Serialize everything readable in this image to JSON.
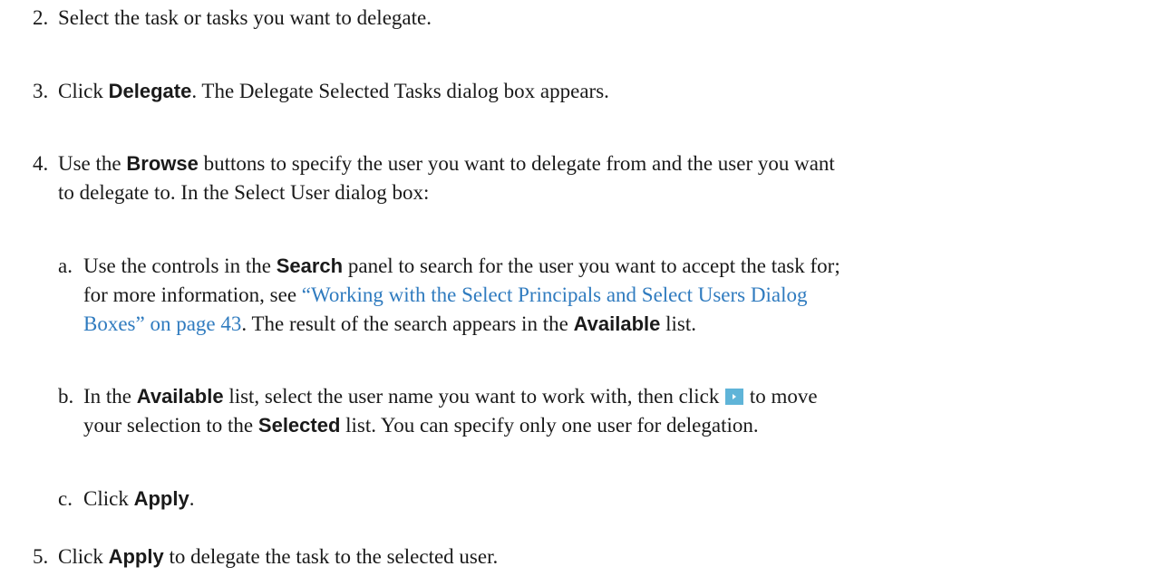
{
  "steps": {
    "s2": {
      "num": "2.",
      "text": "Select the task or tasks you want to delegate."
    },
    "s3": {
      "num": "3.",
      "pre": "Click ",
      "bold": "Delegate",
      "post": ". The Delegate Selected Tasks dialog box appears."
    },
    "s4": {
      "num": "4.",
      "pre": "Use the ",
      "bold": "Browse",
      "post": " buttons to specify the user you want to delegate from and the user you want",
      "line2": "to delegate to. In the Select User dialog box:",
      "a": {
        "num": "a.",
        "pre": "Use the controls in the ",
        "bold": "Search",
        "post": " panel to search for the user you want to accept the task for;",
        "line2_pre": "for more information, see ",
        "link1": "“Working with the Select Principals and Select Users Dialog",
        "link2": "Boxes” on page 43",
        "line3_post": ". The result of the search appears in the ",
        "bold2": "Available",
        "line3_end": " list."
      },
      "b": {
        "num": "b.",
        "pre": "In the ",
        "bold": "Available",
        "mid": " list, select the user name you want to work with, then click ",
        "button_icon": "move-right-arrow-icon",
        "post": " to move",
        "line2_pre": "your selection to the ",
        "bold2": "Selected",
        "line2_post": " list. You can specify only one user for delegation."
      },
      "c": {
        "num": "c.",
        "pre": "Click ",
        "bold": "Apply",
        "post": "."
      }
    },
    "s5": {
      "num": "5.",
      "pre": "Click ",
      "bold": "Apply",
      "post": " to delegate the task to the selected user."
    }
  },
  "colors": {
    "text": "#1a1a1a",
    "link": "#2f7bbf",
    "button": "#5fb4d8"
  }
}
